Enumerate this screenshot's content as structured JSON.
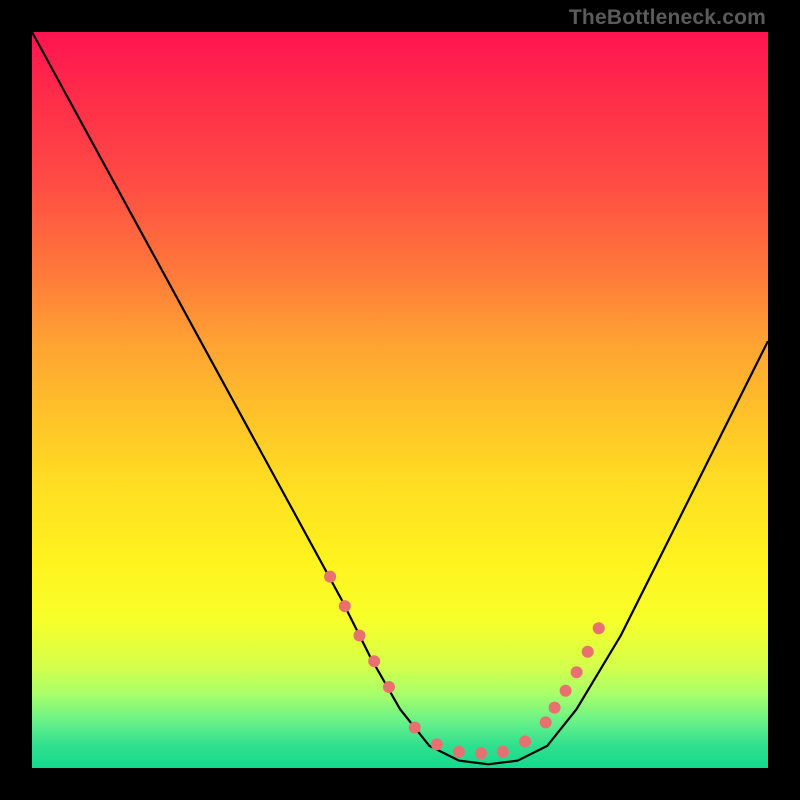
{
  "watermark": "TheBottleneck.com",
  "chart_data": {
    "type": "line",
    "title": "",
    "xlabel": "",
    "ylabel": "",
    "xlim": [
      0,
      100
    ],
    "ylim": [
      0,
      100
    ],
    "grid": false,
    "legend": false,
    "series": [
      {
        "name": "curve",
        "color": "#000000",
        "x": [
          0,
          6,
          12,
          18,
          24,
          30,
          36,
          42,
          46,
          50,
          54,
          58,
          62,
          66,
          70,
          74,
          80,
          86,
          92,
          100
        ],
        "y": [
          100,
          89,
          78,
          67,
          56,
          45,
          34,
          23,
          15,
          8,
          3,
          1,
          0.5,
          1,
          3,
          8,
          18,
          30,
          42,
          58
        ]
      }
    ],
    "markers": {
      "name": "dots",
      "color": "#e87070",
      "radius_px": 6,
      "x": [
        40.5,
        42.5,
        44.5,
        46.5,
        48.5,
        52,
        55,
        58,
        61,
        64,
        67,
        69.8,
        71,
        72.5,
        74,
        75.5,
        77
      ],
      "y": [
        26,
        22,
        18,
        14.5,
        11,
        5.5,
        3.2,
        2.2,
        2,
        2.2,
        3.6,
        6.2,
        8.2,
        10.5,
        13,
        15.8,
        19
      ]
    },
    "background_gradient": {
      "direction": "vertical",
      "stops": [
        {
          "pos": 0.0,
          "color": "#ff1450"
        },
        {
          "pos": 0.2,
          "color": "#ff4a44"
        },
        {
          "pos": 0.42,
          "color": "#ffa133"
        },
        {
          "pos": 0.62,
          "color": "#ffdf22"
        },
        {
          "pos": 0.8,
          "color": "#f7ff2a"
        },
        {
          "pos": 0.94,
          "color": "#62f08a"
        },
        {
          "pos": 1.0,
          "color": "#13d98c"
        }
      ]
    }
  }
}
